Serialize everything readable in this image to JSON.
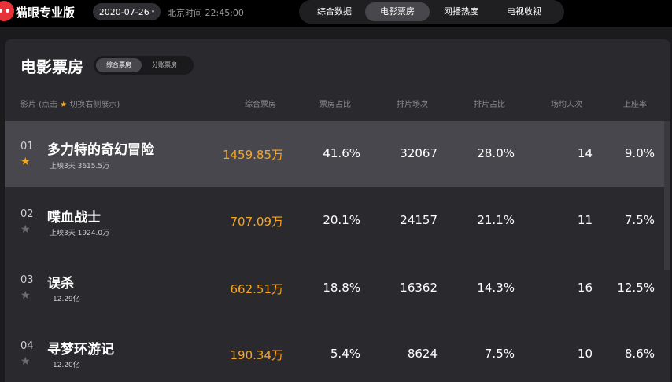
{
  "topbar": {
    "brand": "猫眼专业版",
    "date": "2020-07-26",
    "timestamp": "北京时间 22:45:00",
    "tabs": [
      "综合数据",
      "电影票房",
      "网播热度",
      "电视收视"
    ],
    "active_tab": "电影票房"
  },
  "panel": {
    "title": "电影票房",
    "toggle": [
      "综合票房",
      "分账票房"
    ],
    "toggle_active": "综合票房"
  },
  "header": {
    "film_prefix": "影片 (点击",
    "star": "★",
    "film_suffix": "切换右侧展示)",
    "columns": [
      "综合票房",
      "票房占比",
      "排片场次",
      "排片占比",
      "场均人次",
      "上座率"
    ]
  },
  "rows": [
    {
      "rank": "01",
      "title": "多力特的奇幻冒险",
      "sub": "上映3天  3615.5万",
      "starred": true,
      "box": "1459.85万",
      "box_share": "41.6%",
      "screenings": "32067",
      "screening_share": "28.0%",
      "avg_attendance": "14",
      "occupancy": "9.0%"
    },
    {
      "rank": "02",
      "title": "喋血战士",
      "sub": "上映3天  1924.0万",
      "starred": false,
      "box": "707.09万",
      "box_share": "20.1%",
      "screenings": "24157",
      "screening_share": "21.1%",
      "avg_attendance": "11",
      "occupancy": "7.5%"
    },
    {
      "rank": "03",
      "title": "误杀",
      "sub": "12.29亿",
      "starred": false,
      "box": "662.51万",
      "box_share": "18.8%",
      "screenings": "16362",
      "screening_share": "14.3%",
      "avg_attendance": "16",
      "occupancy": "12.5%"
    },
    {
      "rank": "04",
      "title": "寻梦环游记",
      "sub": "12.20亿",
      "starred": false,
      "box": "190.34万",
      "box_share": "5.4%",
      "screenings": "8624",
      "screening_share": "7.5%",
      "avg_attendance": "10",
      "occupancy": "8.6%"
    }
  ],
  "colors": {
    "accent": "#f5a623",
    "brand_red": "#e6333a",
    "highlight_row": "#48474d"
  },
  "icons": {
    "logo": "cat-logo-icon",
    "star": "star-icon",
    "dropdown": "chevron-down-icon"
  }
}
